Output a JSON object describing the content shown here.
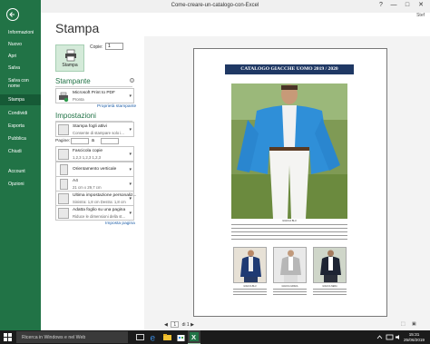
{
  "window": {
    "title": "Come-creare-un-catalogo-con-Excel",
    "user": "Stef",
    "controls": [
      "?",
      "—",
      "□",
      "✕"
    ]
  },
  "backstage": {
    "items": [
      {
        "label": "Informazioni",
        "active": false
      },
      {
        "label": "Nuovo",
        "active": false
      },
      {
        "label": "Apri",
        "active": false
      },
      {
        "label": "Salva",
        "active": false
      },
      {
        "label": "Salva con nome",
        "active": false
      },
      {
        "label": "Stampa",
        "active": true
      },
      {
        "label": "Condividi",
        "active": false
      },
      {
        "label": "Esporta",
        "active": false
      },
      {
        "label": "Pubblica",
        "active": false
      },
      {
        "label": "Chiudi",
        "active": false
      },
      {
        "label": "Account",
        "active": false
      },
      {
        "label": "Opzioni",
        "active": false
      }
    ]
  },
  "stampa": {
    "title": "Stampa",
    "print_button": "Stampa",
    "copies_label": "Copie:",
    "copies_value": "1"
  },
  "printer": {
    "header": "Stampante",
    "name": "Microsoft Print to PDF",
    "status": "Pronta",
    "properties_link": "Proprietà stampante"
  },
  "settings": {
    "header": "Impostazioni",
    "options": [
      {
        "line1": "Stampa fogli attivi",
        "line2": "Consente di stampare solo i..."
      },
      {
        "line1": "Fascicola copie",
        "line2": "1,2,3   1,2,3   1,2,3"
      },
      {
        "line1": "Orientamento verticale",
        "line2": ""
      },
      {
        "line1": "A4",
        "line2": "21 cm x 29,7 cm"
      },
      {
        "line1": "Ultima impostazione personaliz...",
        "line2": "Sinistra: 1,8 cm   Destra: 1,8 cm"
      },
      {
        "line1": "Adatta foglio su una pagina",
        "line2": "Riduce le dimensioni della st..."
      }
    ],
    "pages_label": "Pagine:",
    "pages_to": "a",
    "page_setup_link": "Imposta pagina"
  },
  "preview": {
    "catalog_title": "CATALOGO GIACCHE UOMO 2019 / 2020",
    "main_caption": "GIACCA BLU",
    "thumb_captions": [
      "GIACCA BLU",
      "GIACCA GRIGIA",
      "GIACCA NERA"
    ]
  },
  "page_nav": {
    "current": "1",
    "total_label": "di 1"
  },
  "taskbar": {
    "search_placeholder": "Ricerca in Windows e nel Web",
    "time": "15:31",
    "date": "25/06/2019"
  }
}
